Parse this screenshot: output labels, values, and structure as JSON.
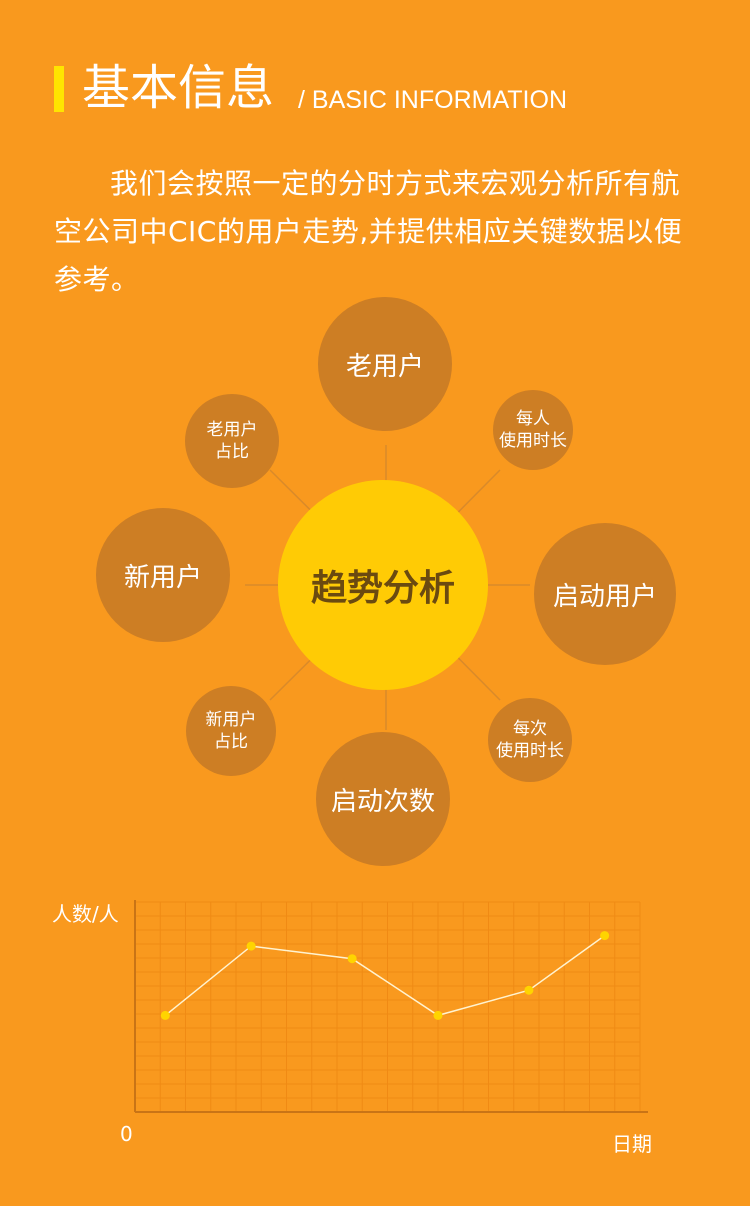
{
  "header": {
    "title": "基本信息",
    "subtitle": "/ BASIC INFORMATION"
  },
  "intro": "我们会按照一定的分时方式来宏观分析所有航空公司中CIC的用户走势,并提供相应关键数据以便参考。",
  "diagram": {
    "center": "趋势分析",
    "nodes": {
      "old_users": "老用户",
      "per_user_duration": "每人\n使用时长",
      "launch_users": "启动用户",
      "per_launch_duration": "每次\n使用时长",
      "launch_count": "启动次数",
      "new_user_ratio": "新用户\n占比",
      "new_users": "新用户",
      "old_user_ratio": "老用户\n占比"
    }
  },
  "chart_data": {
    "type": "line",
    "ylabel": "人数/人",
    "xlabel": "日期",
    "origin_label": "0",
    "grid": true,
    "values": [
      0.46,
      0.79,
      0.73,
      0.46,
      0.58,
      0.84
    ],
    "x_positions": [
      0.06,
      0.23,
      0.43,
      0.6,
      0.78,
      0.93
    ]
  },
  "colors": {
    "background": "#F9991E",
    "bubble": "#CD7E24",
    "center": "#FFCB05",
    "accent_bar": "#FFE500",
    "grid": "#F08A14",
    "point": "#FFD400"
  }
}
